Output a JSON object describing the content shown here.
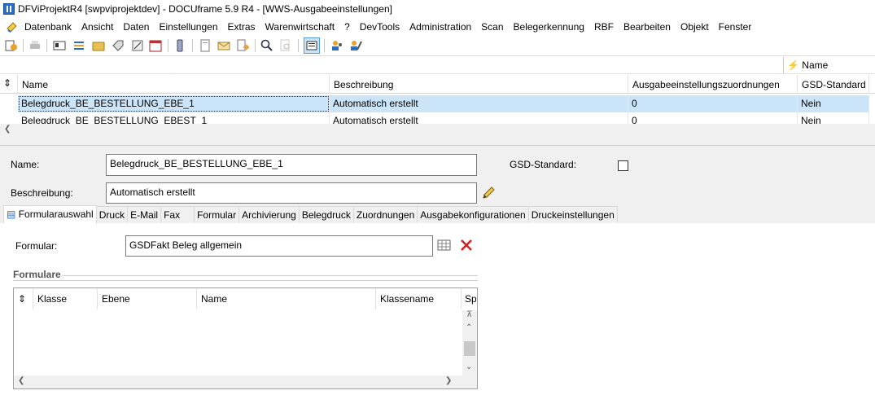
{
  "window": {
    "title": "DFViProjektR4 [swpviprojektdev] - DOCUframe 5.9 R4 - [WWS-Ausgabeeinstellungen]"
  },
  "menu": [
    "Datenbank",
    "Ansicht",
    "Daten",
    "Einstellungen",
    "Extras",
    "Warenwirtschaft",
    "?",
    "DevTools",
    "Administration",
    "Scan",
    "Belegerkennung",
    "RBF",
    "Bearbeiten",
    "Objekt",
    "Fenster"
  ],
  "grid": {
    "sort_label": "Name",
    "columns": [
      "Name",
      "Beschreibung",
      "Ausgabeeinstellungszuordnungen",
      "GSD-Standard"
    ],
    "rows": [
      {
        "name": "Belegdruck_BE_BESTELLUNG_EBE_1",
        "beschreibung": "Automatisch erstellt",
        "zuordnungen": "0",
        "gsd": "Nein"
      },
      {
        "name": "Belegdruck_BE_BESTELLUNG_EBEST_1",
        "beschreibung": "Automatisch erstellt",
        "zuordnungen": "0",
        "gsd": "Nein"
      }
    ]
  },
  "detail": {
    "name_label": "Name:",
    "name_value": "Belegdruck_BE_BESTELLUNG_EBE_1",
    "gsd_label": "GSD-Standard:",
    "gsd_checked": false,
    "beschreibung_label": "Beschreibung:",
    "beschreibung_value": "Automatisch erstellt"
  },
  "tabs": [
    "Formularauswahl",
    "Druck",
    "E-Mail",
    "Fax",
    "Formular",
    "Archivierung",
    "Belegdruck",
    "Zuordnungen",
    "Ausgabekonfigurationen",
    "Druckeinstellungen"
  ],
  "active_tab": "Formularauswahl",
  "formularauswahl": {
    "formular_label": "Formular:",
    "formular_value": "GSDFakt Beleg allgemein",
    "group_title": "Formulare",
    "columns": [
      "Klasse",
      "Ebene",
      "Name",
      "Klassename",
      "Sp"
    ]
  },
  "colors": {
    "selection": "#cce4f7",
    "delete": "#d42020"
  }
}
